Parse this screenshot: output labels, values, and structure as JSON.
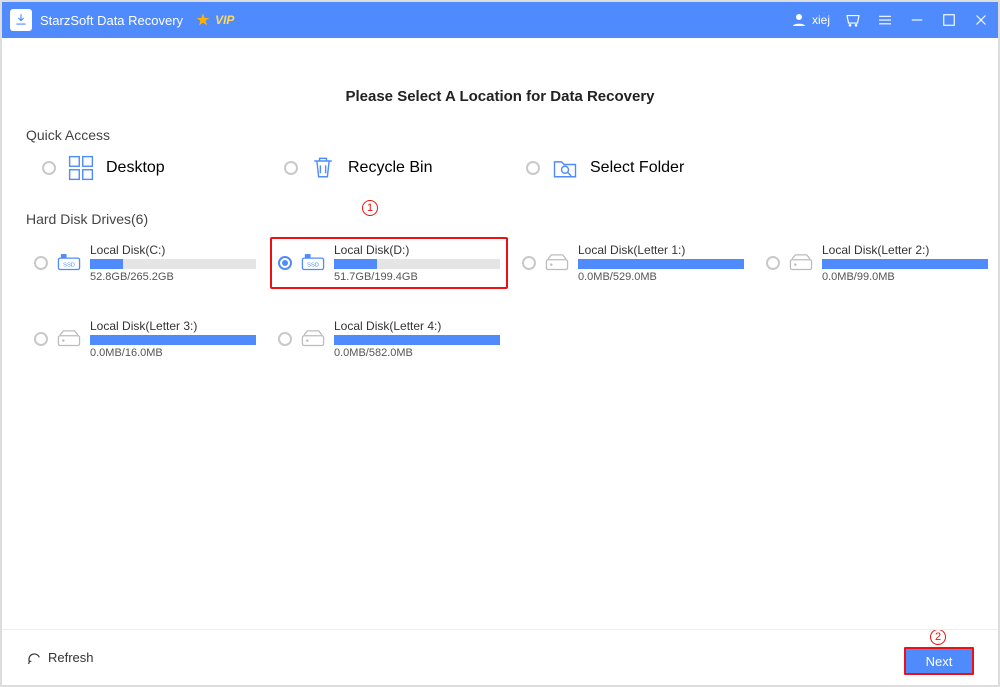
{
  "titlebar": {
    "app_name": "StarzSoft Data Recovery",
    "vip_label": "VIP",
    "username": "xiej"
  },
  "page_title": "Please Select A Location for Data Recovery",
  "quick_access": {
    "label": "Quick Access",
    "items": [
      {
        "label": "Desktop"
      },
      {
        "label": "Recycle Bin"
      },
      {
        "label": "Select Folder"
      }
    ]
  },
  "drives_section": {
    "label": "Hard Disk Drives(6)"
  },
  "drives": [
    {
      "name": "Local Disk(C:)",
      "usage": "52.8GB/265.2GB",
      "fill": 20,
      "type": "ssd",
      "selected": false
    },
    {
      "name": "Local Disk(D:)",
      "usage": "51.7GB/199.4GB",
      "fill": 26,
      "type": "ssd",
      "selected": true
    },
    {
      "name": "Local Disk(Letter 1:)",
      "usage": "0.0MB/529.0MB",
      "fill": 100,
      "type": "hdd-dim",
      "selected": false
    },
    {
      "name": "Local Disk(Letter 2:)",
      "usage": "0.0MB/99.0MB",
      "fill": 100,
      "type": "hdd-dim",
      "selected": false
    },
    {
      "name": "Local Disk(Letter 3:)",
      "usage": "0.0MB/16.0MB",
      "fill": 100,
      "type": "hdd-dim",
      "selected": false
    },
    {
      "name": "Local Disk(Letter 4:)",
      "usage": "0.0MB/582.0MB",
      "fill": 100,
      "type": "hdd-dim",
      "selected": false
    }
  ],
  "footer": {
    "refresh": "Refresh",
    "next": "Next"
  },
  "annotations": {
    "one": "①",
    "two": "②"
  }
}
